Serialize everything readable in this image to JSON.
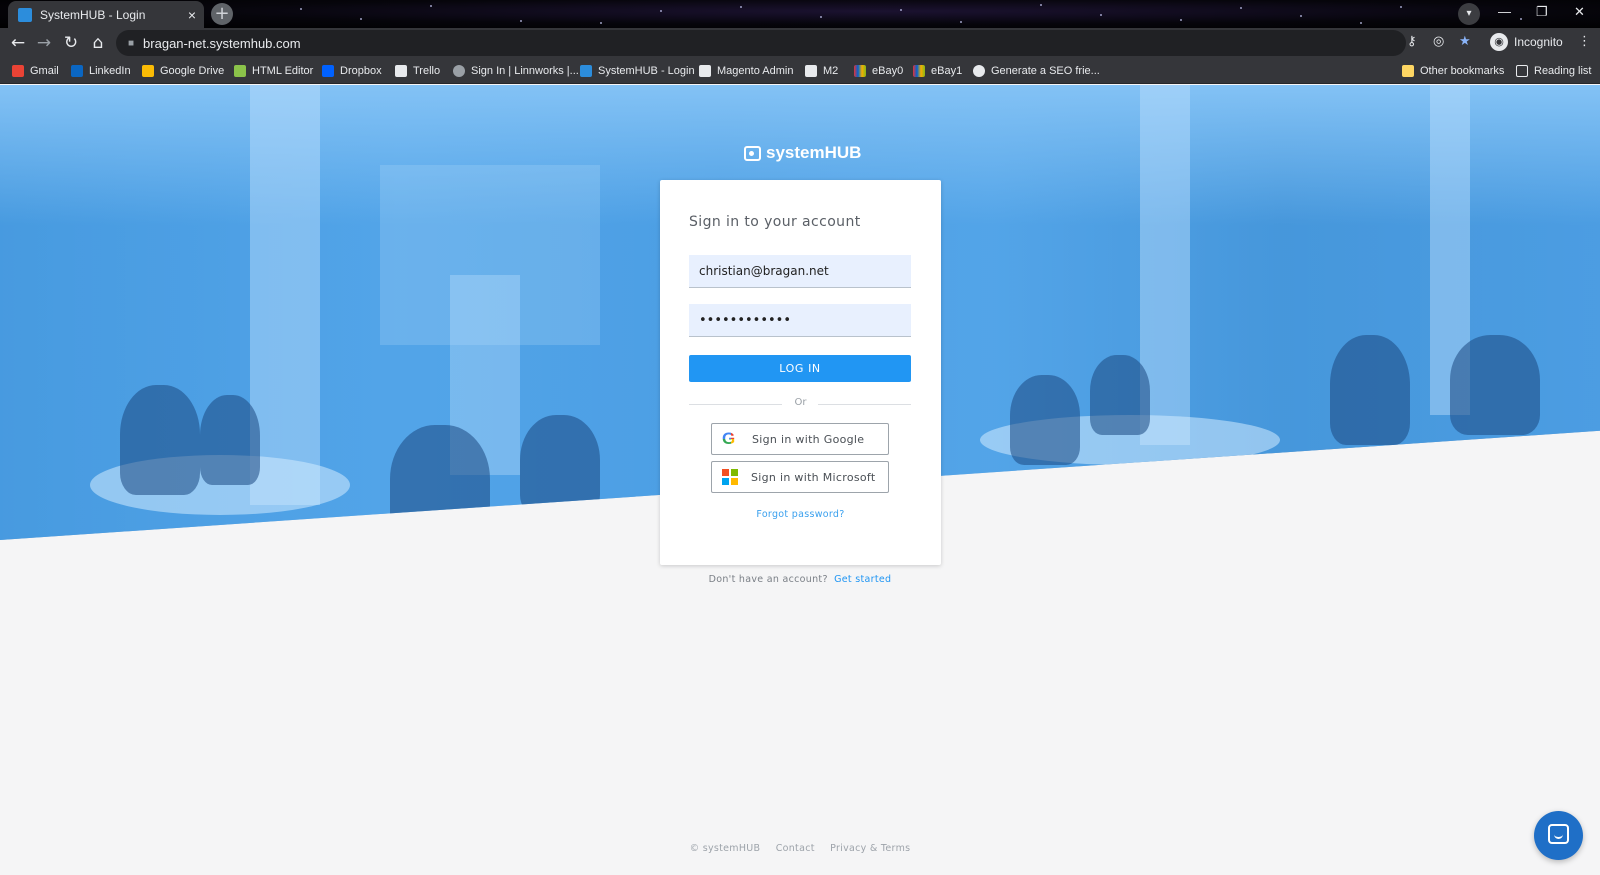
{
  "browser": {
    "tab_title": "SystemHUB - Login",
    "tab_close": "×",
    "new_tab": "+",
    "address": "bragan-net.systemhub.com",
    "profile_label": "Incognito",
    "window_minimize": "—",
    "window_restore": "❐",
    "window_close": "✕",
    "menu": "⋮",
    "bookmarks": [
      {
        "label": "Gmail",
        "color": "#ea4335"
      },
      {
        "label": "LinkedIn",
        "color": "#0a66c2"
      },
      {
        "label": "Google Drive",
        "color": "#fbbc05"
      },
      {
        "label": "HTML Editor",
        "color": "#8bc34a"
      },
      {
        "label": "Dropbox",
        "color": "#0061ff"
      },
      {
        "label": "Trello",
        "color": "#e8eaed"
      },
      {
        "label": "Sign In | Linnworks |...",
        "color": "#9aa0a6"
      },
      {
        "label": "SystemHUB - Login",
        "color": "#2c8ddc"
      },
      {
        "label": "Magento Admin",
        "color": "#e8eaed"
      },
      {
        "label": "M2",
        "color": "#e8eaed"
      },
      {
        "label": "eBay0",
        "color": "#e53238"
      },
      {
        "label": "eBay1",
        "color": "#e53238"
      },
      {
        "label": "Generate a SEO frie...",
        "color": "#e8eaed"
      }
    ],
    "other_bookmarks": "Other bookmarks",
    "reading_list": "Reading list"
  },
  "brand": {
    "logo_text": "systemHUB",
    "accent": "#2196f3",
    "overlay": "#42a0ec"
  },
  "login": {
    "title": "Sign in to your account",
    "email_value": "christian@bragan.net",
    "password_value": "••••••••••••",
    "login_button": "LOG IN",
    "or_label": "Or",
    "google_button": "Sign in with Google",
    "microsoft_button": "Sign in with Microsoft",
    "forgot_link": "Forgot password?"
  },
  "signup": {
    "prompt": "Don't have an account?",
    "link": "Get started"
  },
  "footer": {
    "copyright": "© systemHUB",
    "contact": "Contact",
    "privacy": "Privacy & Terms"
  }
}
